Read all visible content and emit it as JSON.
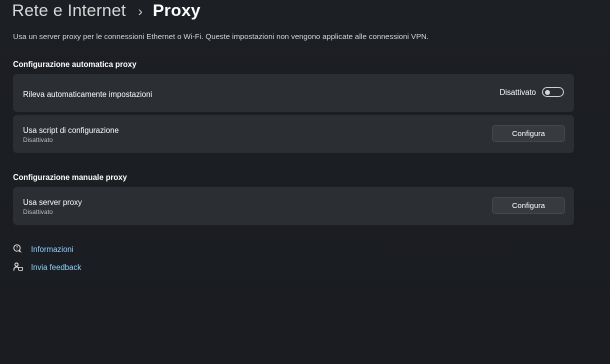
{
  "header": {
    "parent": "Rete e Internet",
    "separator": "›",
    "current": "Proxy"
  },
  "description": "Usa un server proxy per le connessioni Ethernet o Wi-Fi. Queste impostazioni non vengono applicate alle connessioni VPN.",
  "auto_section": {
    "title": "Configurazione automatica proxy",
    "detect": {
      "label": "Rileva automaticamente impostazioni",
      "state_label": "Disattivato",
      "toggle_on": false
    },
    "script": {
      "label": "Usa script di configurazione",
      "status": "Disattivato",
      "button": "Configura"
    }
  },
  "manual_section": {
    "title": "Configurazione manuale proxy",
    "server": {
      "label": "Usa server proxy",
      "status": "Disattivato",
      "button": "Configura"
    }
  },
  "links": {
    "info": "Informazioni",
    "feedback": "Invia feedback"
  },
  "colors": {
    "background": "#1b1d22",
    "card": "#2b2e33",
    "link": "#8fd3ff"
  },
  "icons": {
    "info": "help-chat-icon",
    "feedback": "feedback-icon"
  }
}
